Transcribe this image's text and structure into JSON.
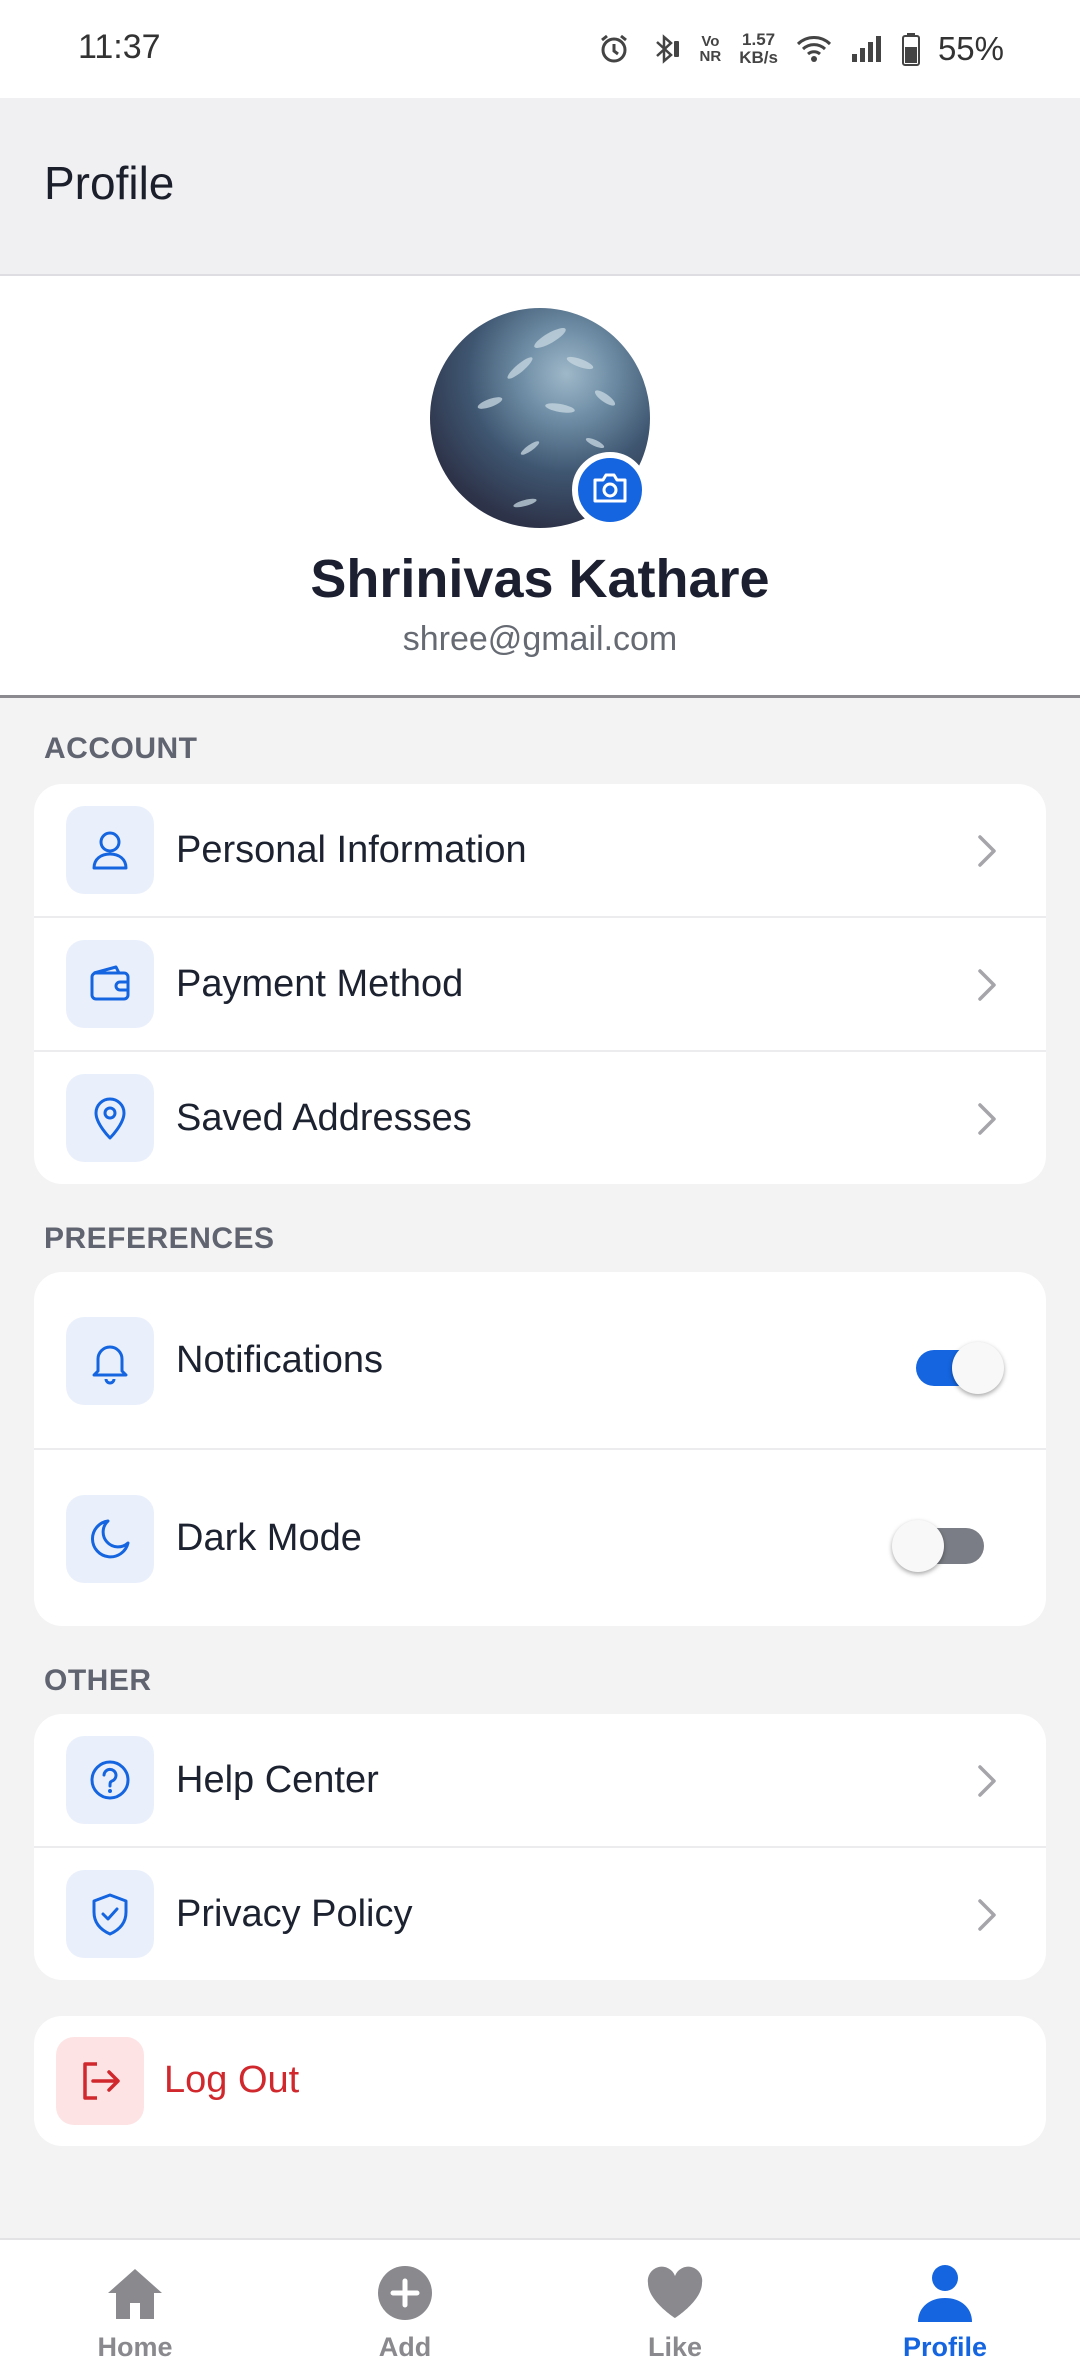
{
  "status_bar": {
    "time": "11:37",
    "volte": [
      "Vo",
      "NR"
    ],
    "speed_value": "1.57",
    "speed_unit": "KB/s",
    "battery": "55%"
  },
  "header": {
    "title": "Profile"
  },
  "profile": {
    "name": "Shrinivas Kathare",
    "email": "shree@gmail.com"
  },
  "sections": {
    "account": {
      "label": "ACCOUNT",
      "items": [
        {
          "label": "Personal Information",
          "icon": "user-icon"
        },
        {
          "label": "Payment Method",
          "icon": "wallet-icon"
        },
        {
          "label": "Saved Addresses",
          "icon": "location-pin-icon"
        }
      ]
    },
    "preferences": {
      "label": "PREFERENCES",
      "items": [
        {
          "label": "Notifications",
          "icon": "bell-icon",
          "enabled": true
        },
        {
          "label": "Dark Mode",
          "icon": "moon-icon",
          "enabled": false
        }
      ]
    },
    "other": {
      "label": "OTHER",
      "items": [
        {
          "label": "Help Center",
          "icon": "help-circle-icon"
        },
        {
          "label": "Privacy Policy",
          "icon": "shield-check-icon"
        }
      ]
    }
  },
  "logout": {
    "label": "Log Out",
    "icon": "logout-icon"
  },
  "bottom_nav": {
    "items": [
      {
        "label": "Home",
        "icon": "home-icon",
        "active": false
      },
      {
        "label": "Add",
        "icon": "add-circle-icon",
        "active": false
      },
      {
        "label": "Like",
        "icon": "heart-icon",
        "active": false
      },
      {
        "label": "Profile",
        "icon": "person-icon",
        "active": true
      }
    ]
  },
  "colors": {
    "accent": "#1565e0",
    "danger": "#d0282d",
    "icon_tile_bg": "#eaf0fb",
    "page_bg": "#f3f3f4",
    "inactive_nav": "#8a8a8e"
  }
}
